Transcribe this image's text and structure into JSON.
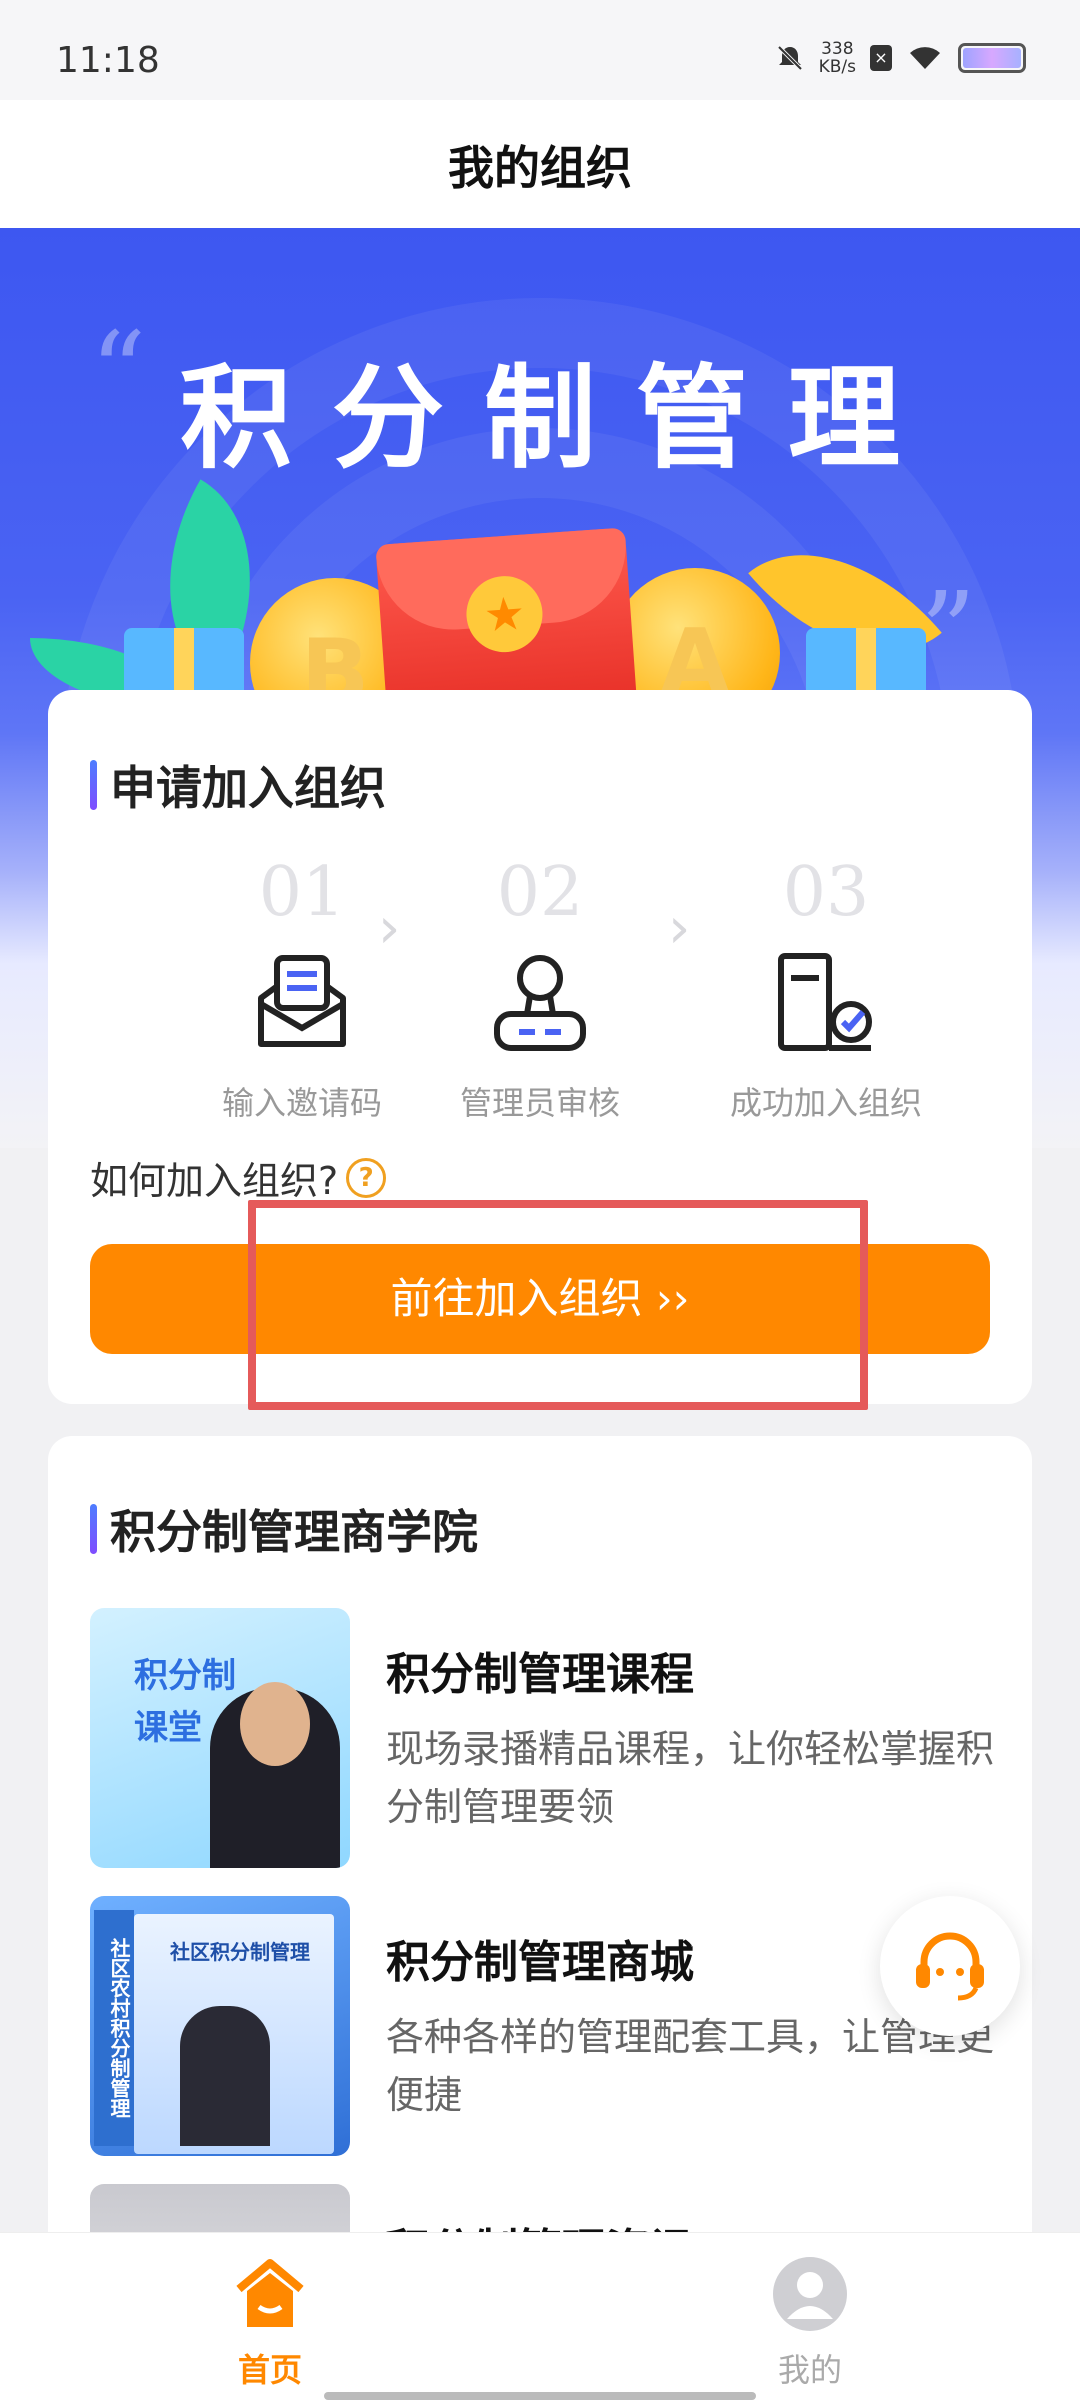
{
  "status_bar": {
    "time": "11:18",
    "net_speed_value": "338",
    "net_speed_unit": "KB/s"
  },
  "header": {
    "title": "我的组织"
  },
  "banner": {
    "title": "积分制管理",
    "coin_left": "B",
    "coin_right": "A"
  },
  "join_card": {
    "title": "申请加入组织",
    "steps": [
      {
        "num": "01",
        "label": "输入邀请码",
        "icon": "envelope-icon"
      },
      {
        "num": "02",
        "label": "管理员审核",
        "icon": "stamp-icon"
      },
      {
        "num": "03",
        "label": "成功加入组织",
        "icon": "document-check-icon"
      }
    ],
    "howto": "如何加入组织?",
    "button": "前往加入组织 ››"
  },
  "academy": {
    "title": "积分制管理商学院",
    "items": [
      {
        "title": "积分制管理课程",
        "desc": "现场录播精品课程，让你轻松掌握积分制管理要领",
        "thumb_text": "积分制课堂"
      },
      {
        "title": "积分制管理商城",
        "desc": "各种各样的管理配套工具，让管理更便捷",
        "thumb_spine": "社区农村积分制管理",
        "thumb_book_title": "社区积分制管理"
      },
      {
        "title": "积分制管理资讯",
        "desc": ""
      }
    ]
  },
  "bottom_nav": {
    "home": "首页",
    "mine": "我的"
  },
  "colors": {
    "primary_orange": "#ff8800",
    "banner_blue": "#3d57f1",
    "highlight_red": "#e55a5a"
  }
}
